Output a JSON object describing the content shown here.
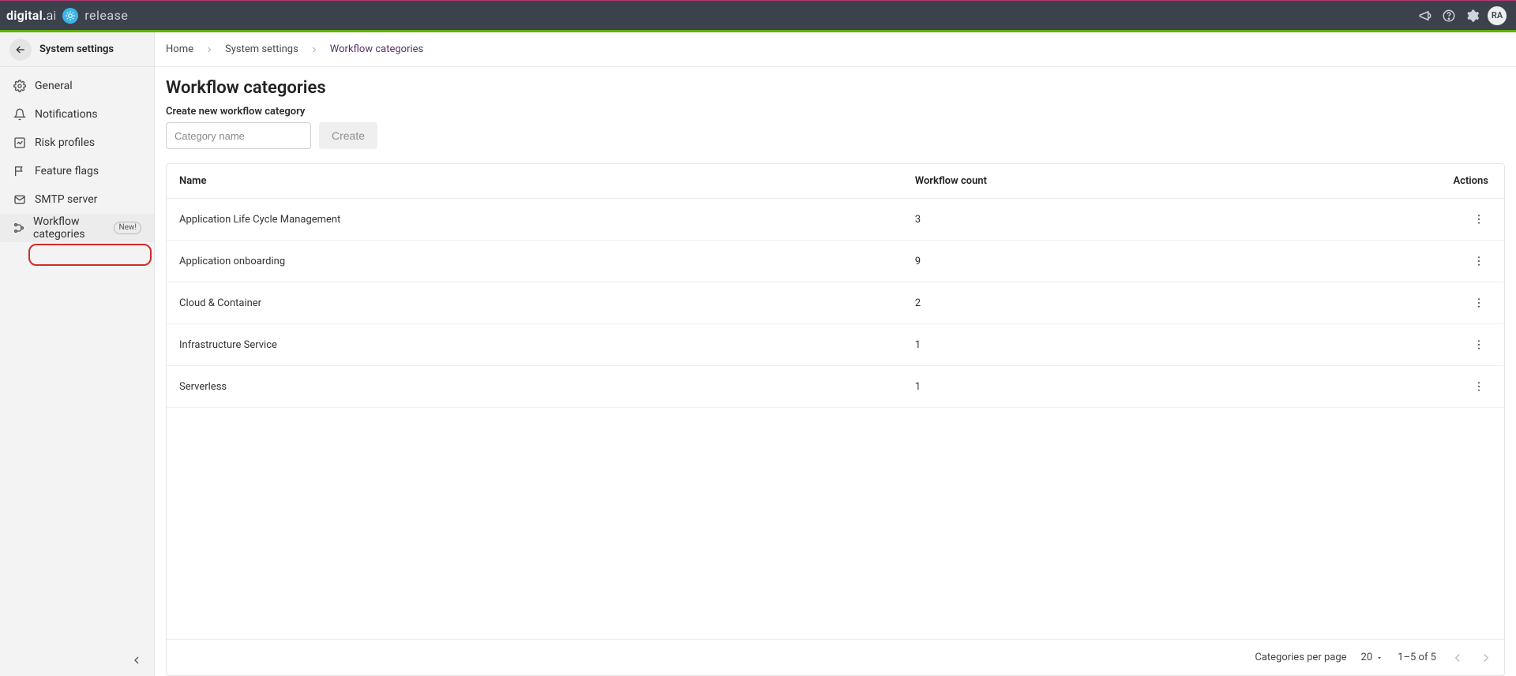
{
  "topbar": {
    "brand_primary": "digital.ai",
    "brand_product": "release",
    "avatar_initials": "RA"
  },
  "sidebar": {
    "title": "System settings",
    "items": [
      {
        "label": "General"
      },
      {
        "label": "Notifications"
      },
      {
        "label": "Risk profiles"
      },
      {
        "label": "Feature flags"
      },
      {
        "label": "SMTP server"
      },
      {
        "label": "Workflow categories",
        "badge": "New!"
      }
    ]
  },
  "breadcrumb": {
    "items": [
      "Home",
      "System settings",
      "Workflow categories"
    ]
  },
  "page": {
    "title": "Workflow categories",
    "create_label": "Create new workflow category",
    "input_placeholder": "Category name",
    "create_button": "Create"
  },
  "table": {
    "headers": {
      "name": "Name",
      "count": "Workflow count",
      "actions": "Actions"
    },
    "rows": [
      {
        "name": "Application Life Cycle Management",
        "count": "3"
      },
      {
        "name": "Application onboarding",
        "count": "9"
      },
      {
        "name": "Cloud & Container",
        "count": "2"
      },
      {
        "name": "Infrastructure Service",
        "count": "1"
      },
      {
        "name": "Serverless",
        "count": "1"
      }
    ]
  },
  "pager": {
    "per_page_label": "Categories per page",
    "per_page_value": "20",
    "range": "1–5 of 5"
  }
}
